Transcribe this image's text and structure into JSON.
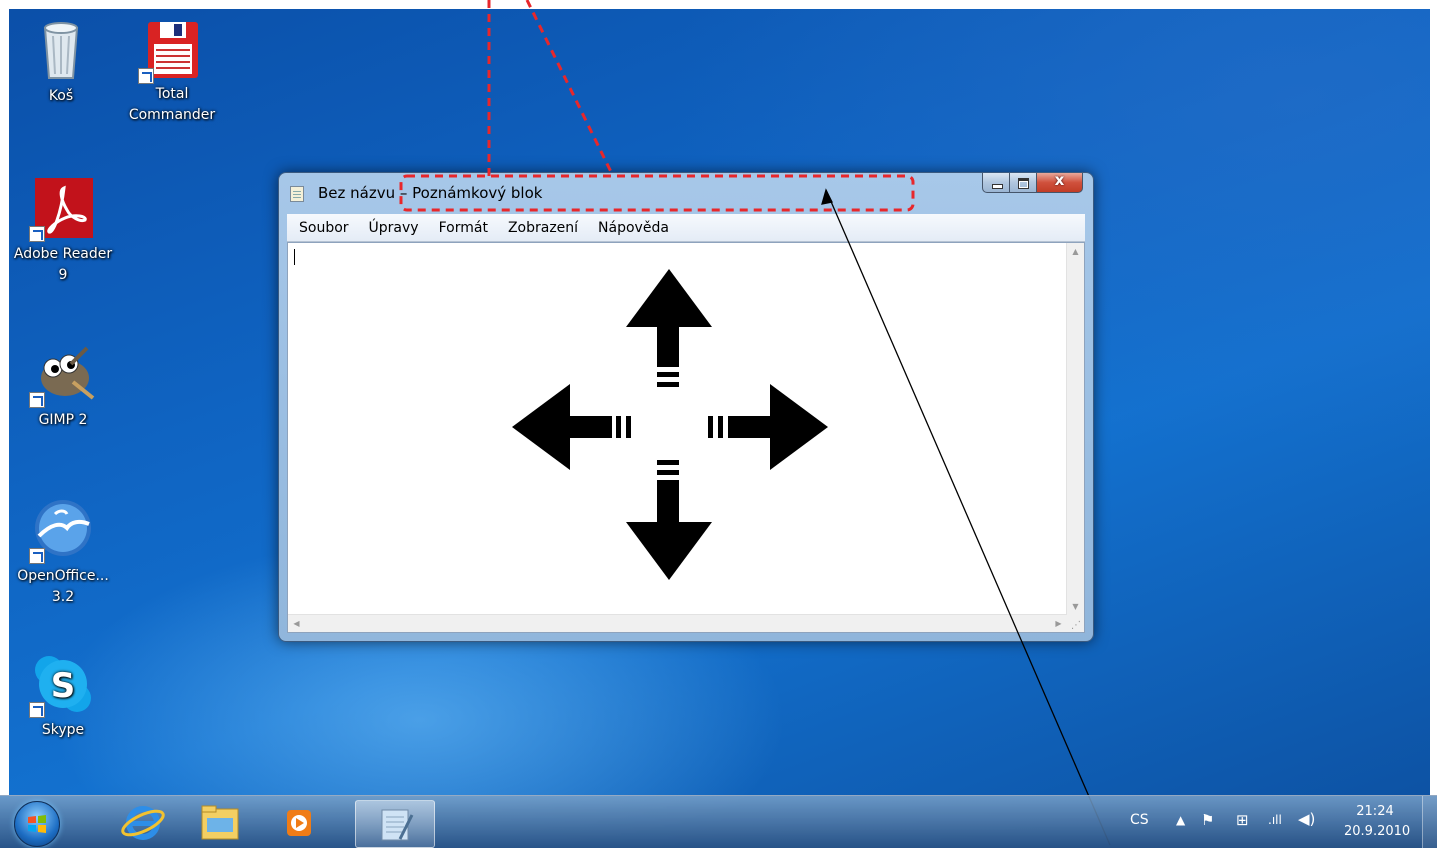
{
  "desktop": {
    "icons": [
      {
        "label": "Koš",
        "icon": "recycle-bin-icon"
      },
      {
        "label": "Total Commander",
        "icon": "total-commander-icon"
      },
      {
        "label": "Adobe Reader 9",
        "icon": "adobe-reader-icon"
      },
      {
        "label": "GIMP 2",
        "icon": "gimp-icon"
      },
      {
        "label": "OpenOffice... 3.2",
        "icon": "openoffice-icon"
      },
      {
        "label": "Skype",
        "icon": "skype-icon"
      }
    ]
  },
  "window": {
    "title_doc": "Bez názvu",
    "title_sep": " – ",
    "title_app": "Poznámkový blok",
    "menu": [
      "Soubor",
      "Úpravy",
      "Formát",
      "Zobrazení",
      "Nápověda"
    ],
    "editor_text": ""
  },
  "taskbar": {
    "apps": [
      {
        "icon": "internet-explorer-icon"
      },
      {
        "icon": "windows-explorer-icon"
      },
      {
        "icon": "media-player-icon"
      },
      {
        "icon": "notepad-icon",
        "active": true
      }
    ],
    "language": "CS",
    "time": "21:24",
    "date": "20.9.2010"
  },
  "colors": {
    "annotation_red": "#e8272b",
    "desktop_blue": "#0f63c1"
  }
}
